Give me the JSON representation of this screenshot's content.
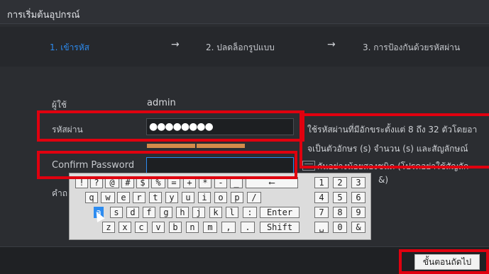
{
  "window": {
    "title": "การเริ่มต้นอุปกรณ์"
  },
  "steps": [
    {
      "label": "1.  เข้ารหัส",
      "active": true
    },
    {
      "label": "2.  ปลดล็อกรูปแบบ",
      "active": false
    },
    {
      "label": "3.  การป้องกันด้วยรหัสผ่าน",
      "active": false
    }
  ],
  "arrow_glyph": "→",
  "form": {
    "user_label": "ผู้ใช้",
    "user_value": "admin",
    "password_label": "รหัสผ่าน",
    "password_value": "●●●●●●●●",
    "confirm_label": "Confirm Password",
    "confirm_value": "",
    "question_label_partial": "คำถ"
  },
  "hint_lines": [
    "ใช้รหัสผ่านที่มีอักขระตั้งแต่ 8 ถึง 32 ตัวโดยอา",
    "จเป็นตัวอักษร (s) จำนวน (s) และสัญลักษณ์",
    "กันอย่างน้อยสองชนิด (โปรดอย่าใช้สัญลัก",
    "&)"
  ],
  "keyboard": {
    "row1": [
      "!",
      "?",
      "@",
      "#",
      "$",
      "%",
      "=",
      "+",
      "*",
      "-",
      "_",
      "⟵"
    ],
    "row2": [
      "q",
      "w",
      "e",
      "r",
      "t",
      "y",
      "u",
      "i",
      "o",
      "p",
      "/"
    ],
    "row3": [
      "a",
      "s",
      "d",
      "f",
      "g",
      "h",
      "j",
      "k",
      "l",
      ":",
      "Enter"
    ],
    "row4": [
      "z",
      "x",
      "c",
      "v",
      "b",
      "n",
      "m",
      ",",
      ".",
      "Shift"
    ],
    "numpad": [
      "1",
      "2",
      "3",
      "4",
      "5",
      "6",
      "7",
      "8",
      "9",
      "␣",
      "0",
      "&"
    ]
  },
  "footer": {
    "next_label": "ขั้นตอนถัดไป"
  },
  "colors": {
    "accent": "#2d8cf0",
    "highlight": "#e0000f",
    "strength": "#d48b4a"
  }
}
